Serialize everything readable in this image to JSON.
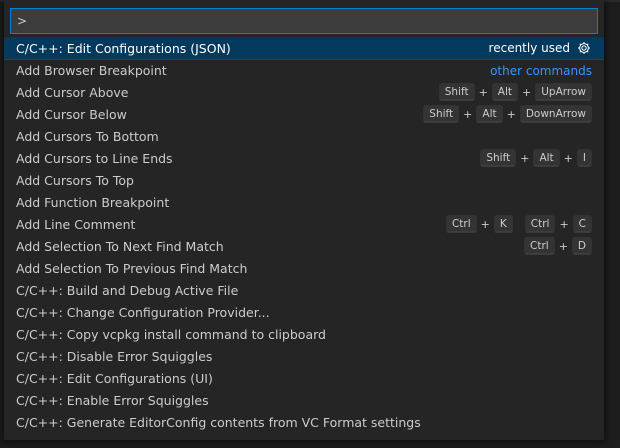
{
  "input": {
    "value": ">",
    "placeholder": ""
  },
  "items": [
    {
      "label": "C/C++: Edit Configurations (JSON)",
      "badge": "recently used",
      "icon": "gear-icon",
      "selected": true
    },
    {
      "label": "Add Browser Breakpoint",
      "badge_link": "other commands"
    },
    {
      "label": "Add Cursor Above",
      "keys": [
        [
          "Shift",
          "Alt",
          "UpArrow"
        ]
      ]
    },
    {
      "label": "Add Cursor Below",
      "keys": [
        [
          "Shift",
          "Alt",
          "DownArrow"
        ]
      ]
    },
    {
      "label": "Add Cursors To Bottom"
    },
    {
      "label": "Add Cursors to Line Ends",
      "keys": [
        [
          "Shift",
          "Alt",
          "I"
        ]
      ]
    },
    {
      "label": "Add Cursors To Top"
    },
    {
      "label": "Add Function Breakpoint"
    },
    {
      "label": "Add Line Comment",
      "keys": [
        [
          "Ctrl",
          "K"
        ],
        [
          "Ctrl",
          "C"
        ]
      ]
    },
    {
      "label": "Add Selection To Next Find Match",
      "keys": [
        [
          "Ctrl",
          "D"
        ]
      ]
    },
    {
      "label": "Add Selection To Previous Find Match"
    },
    {
      "label": "C/C++: Build and Debug Active File"
    },
    {
      "label": "C/C++: Change Configuration Provider..."
    },
    {
      "label": "C/C++: Copy vcpkg install command to clipboard"
    },
    {
      "label": "C/C++: Disable Error Squiggles"
    },
    {
      "label": "C/C++: Edit Configurations (UI)"
    },
    {
      "label": "C/C++: Enable Error Squiggles"
    },
    {
      "label": "C/C++: Generate EditorConfig contents from VC Format settings"
    }
  ],
  "colors": {
    "selected_bg": "#04395e",
    "link": "#3794ff",
    "focus_border": "#007fd4",
    "panel_bg": "#252526"
  }
}
